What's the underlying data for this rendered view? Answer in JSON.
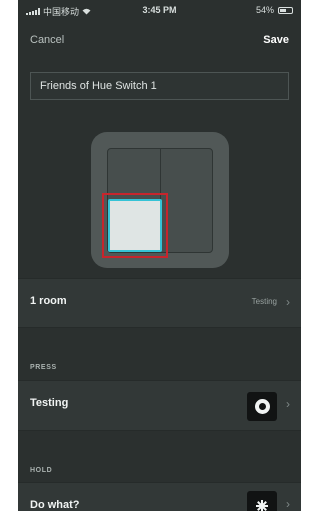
{
  "status_bar": {
    "carrier": "中国移动",
    "time": "3:45 PM",
    "battery": "54%",
    "battery_level": 0.54
  },
  "nav": {
    "cancel_label": "Cancel",
    "save_label": "Save"
  },
  "switch_name": {
    "value": "Friends of Hue Switch 1",
    "placeholder": "Friends of Hue Switch 1"
  },
  "room_row": {
    "label": "1 room",
    "value": "Testing",
    "chevron": "›"
  },
  "press_section": {
    "heading": "PRESS",
    "label": "Testing",
    "icon": "scene-ring-icon",
    "chevron": "›"
  },
  "hold_section": {
    "heading": "HOLD",
    "label": "Do what?",
    "icon": "brightness-icon",
    "chevron": "›"
  },
  "colors": {
    "background": "#2b302f",
    "row_background": "#323837",
    "highlight_red": "#c7252c",
    "selected_cyan": "#35c3d6"
  }
}
